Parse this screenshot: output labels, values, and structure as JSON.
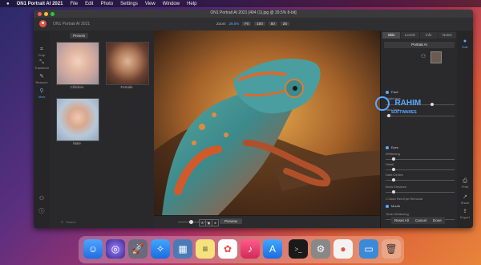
{
  "menubar": {
    "apple": "",
    "app": "ON1 Portrait AI 2021",
    "items": [
      "File",
      "Edit",
      "Photo",
      "Settings",
      "View",
      "Window",
      "Help"
    ]
  },
  "window": {
    "title": "ON1 Portrait AI 2021 [404 (1).jpg @ 29.5% 8-bit]"
  },
  "header": {
    "app_name": "ON1 Portrait AI 2021",
    "zoom_label": "Zoom",
    "zoom_value": "29.5%",
    "zoom_buttons": [
      "Fit",
      "100",
      "50",
      "25"
    ]
  },
  "left_tools": [
    {
      "icon": "crop-icon",
      "label": "Crop"
    },
    {
      "icon": "transform-icon",
      "label": "Transform"
    },
    {
      "icon": "retouch-icon",
      "label": "Retouch"
    },
    {
      "icon": "view-icon",
      "label": "View"
    }
  ],
  "browser": {
    "tab": "Presets",
    "thumbs": [
      {
        "label": "Children"
      },
      {
        "label": "Female"
      },
      {
        "label": "Male"
      }
    ],
    "search_placeholder": "Search"
  },
  "bottom_bar": {
    "preview_label": "Preview"
  },
  "right_panel": {
    "tabs": [
      "Skin",
      "Levels",
      "Info",
      "Notes"
    ],
    "active_tab": "Skin",
    "title": "Portrait AI",
    "rows": [
      {
        "label": "Face",
        "section": true
      },
      {
        "label": "Brightness"
      },
      {
        "label": "Skin Tone"
      },
      {
        "label": "Eyes",
        "section": true
      },
      {
        "label": "Whitening"
      },
      {
        "label": "Detail"
      },
      {
        "label": "Dark Circles"
      },
      {
        "label": "Brow Enhance"
      },
      {
        "label": "Auto Red Eye Removal"
      },
      {
        "label": "Mouth",
        "section": true
      },
      {
        "label": "Teeth Whitening"
      }
    ],
    "footer_buttons": [
      "Reset All",
      "Cancel",
      "Done"
    ]
  },
  "right_side": [
    {
      "icon": "edit-icon",
      "label": "Edit"
    },
    {
      "icon": "print-icon",
      "label": "Print"
    },
    {
      "icon": "share-icon",
      "label": "Share"
    },
    {
      "icon": "export-icon",
      "label": "Export"
    }
  ],
  "watermark": {
    "line1": "RAHIM",
    "line2": "SOFTWARES"
  },
  "colors": {
    "accent": "#5aa9ff",
    "brand": "#e0524a"
  }
}
